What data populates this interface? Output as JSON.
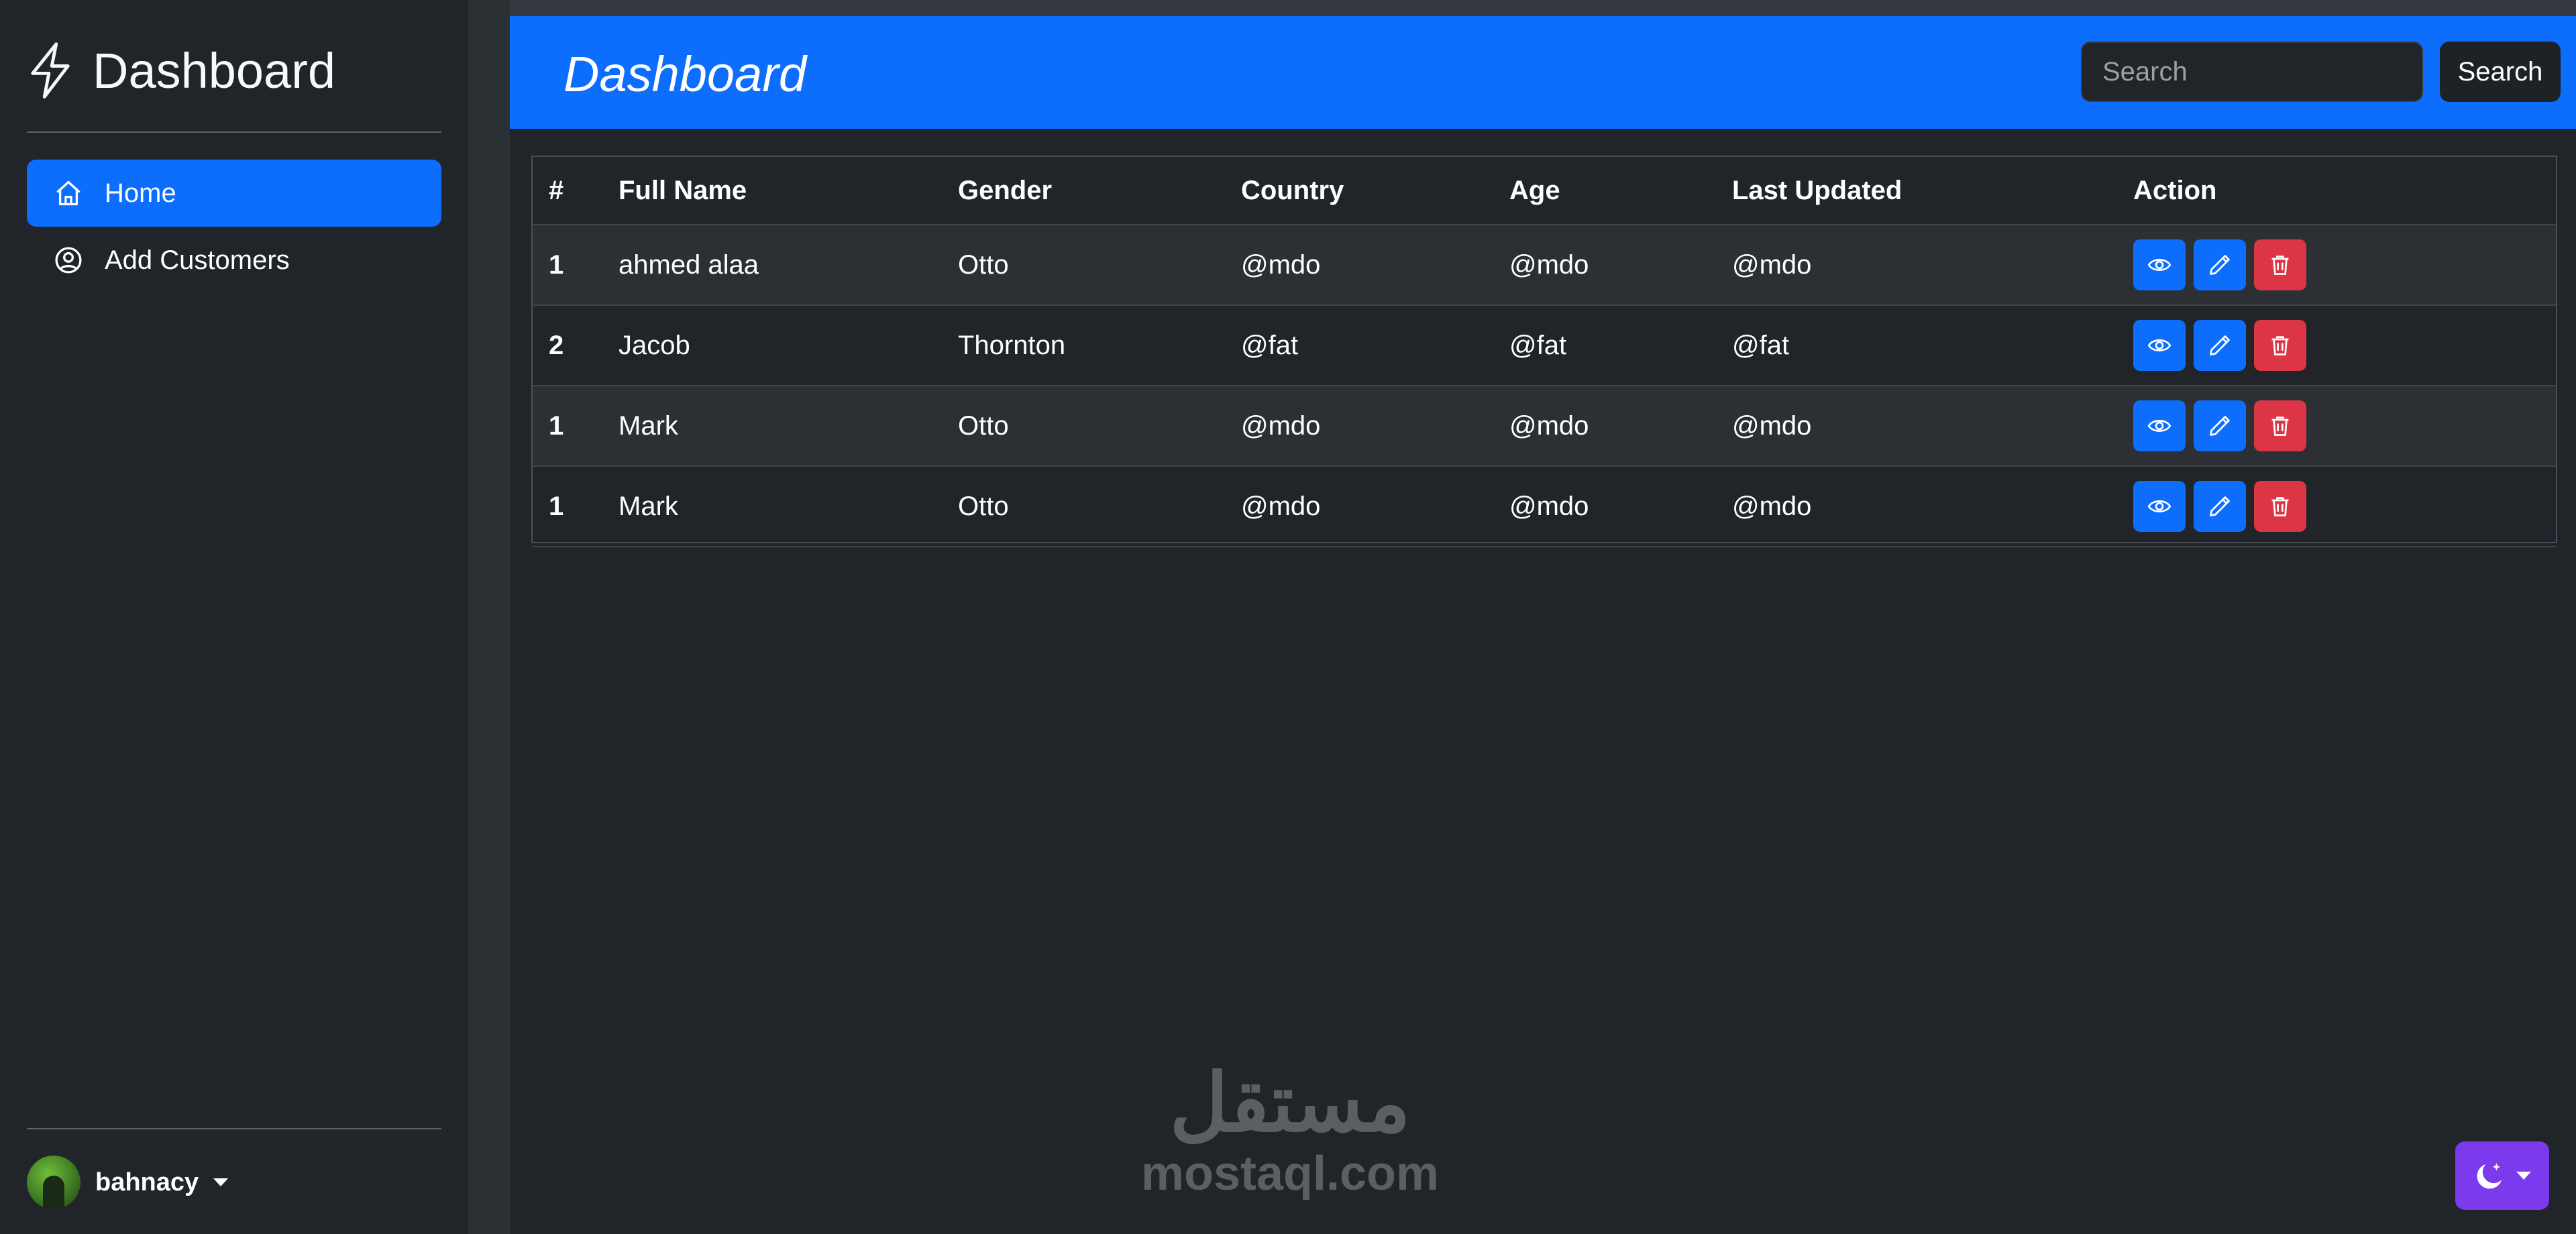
{
  "sidebar": {
    "brand": "Dashboard",
    "nav": [
      {
        "label": "Home",
        "icon": "home-icon",
        "active": true
      },
      {
        "label": "Add Customers",
        "icon": "user-circle-icon",
        "active": false
      }
    ],
    "user": {
      "name": "bahnacy"
    }
  },
  "header": {
    "title": "Dashboard",
    "search_placeholder": "Search",
    "search_button": "Search"
  },
  "table": {
    "columns": [
      "#",
      "Full Name",
      "Gender",
      "Country",
      "Age",
      "Last Updated",
      "Action"
    ],
    "rows": [
      {
        "num": "1",
        "name": "ahmed alaa",
        "gender": "Otto",
        "country": "@mdo",
        "age": "@mdo",
        "updated": "@mdo"
      },
      {
        "num": "2",
        "name": "Jacob",
        "gender": "Thornton",
        "country": "@fat",
        "age": "@fat",
        "updated": "@fat"
      },
      {
        "num": "1",
        "name": "Mark",
        "gender": "Otto",
        "country": "@mdo",
        "age": "@mdo",
        "updated": "@mdo"
      },
      {
        "num": "1",
        "name": "Mark",
        "gender": "Otto",
        "country": "@mdo",
        "age": "@mdo",
        "updated": "@mdo"
      }
    ],
    "actions": [
      "eye-icon",
      "pencil-icon",
      "trash-icon"
    ]
  },
  "watermark": {
    "arabic": "مستقل",
    "latin": "mostaql.com"
  },
  "theme_toggle": {
    "icon": "moon-stars-icon"
  },
  "colors": {
    "primary": "#0d6efd",
    "danger": "#dc3545",
    "background": "#212529",
    "theme_toggle": "#7c3aed"
  }
}
